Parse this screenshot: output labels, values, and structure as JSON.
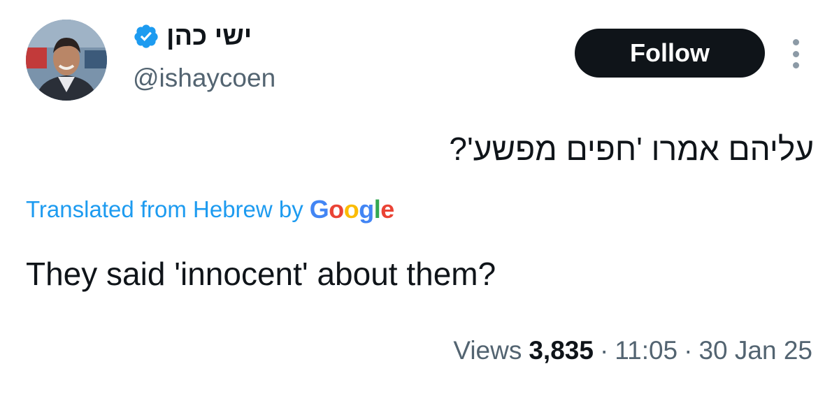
{
  "author": {
    "display_name": "ישי כהן",
    "handle": "@ishaycoen",
    "verified_icon": "verified-badge-icon",
    "verified_color": "#1d9bf0"
  },
  "actions": {
    "follow_label": "Follow",
    "more_icon": "more-vertical-icon"
  },
  "tweet": {
    "original_text": "עליהם אמרו 'חפים מפשע'?",
    "translation_label": "Translated from Hebrew by",
    "translation_provider": "Google",
    "translated_text": "They said 'innocent' about them?"
  },
  "meta": {
    "views_label": "Views",
    "views_count": "3,835",
    "separator": "·",
    "time": "11:05",
    "date": "30 Jan 25"
  },
  "colors": {
    "text_primary": "#0f1419",
    "text_secondary": "#536471",
    "link": "#1d9bf0",
    "follow_bg": "#0f1419"
  }
}
